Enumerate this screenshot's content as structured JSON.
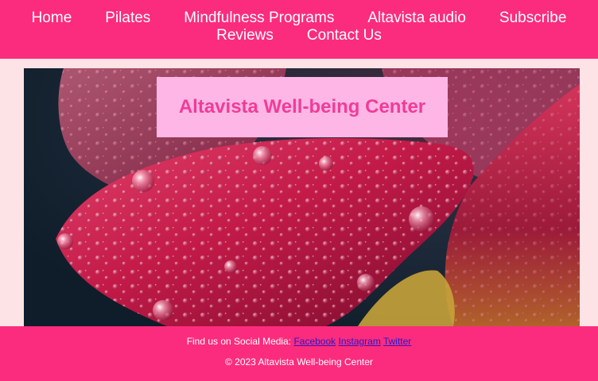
{
  "nav": {
    "items": [
      {
        "label": "Home"
      },
      {
        "label": "Pilates"
      },
      {
        "label": "Mindfulness Programs"
      },
      {
        "label": "Altavista audio"
      },
      {
        "label": "Subscribe"
      },
      {
        "label": "Reviews"
      },
      {
        "label": "Contact Us"
      }
    ]
  },
  "hero": {
    "title": "Altavista Well-being Center",
    "image": "red-tulip-petal-water-droplets"
  },
  "footer": {
    "social_prefix": "Find us on Social Media:",
    "links": [
      {
        "label": "Facebook"
      },
      {
        "label": "Instagram"
      },
      {
        "label": "Twitter"
      }
    ],
    "copyright": "© 2023 Altavista Well-being Center"
  },
  "colors": {
    "nav_bg": "#fb2c7d",
    "page_bg": "#fde3e5",
    "title_box": "#fdb6e6",
    "title_text": "#f03c97",
    "link": "#2b17c9"
  }
}
